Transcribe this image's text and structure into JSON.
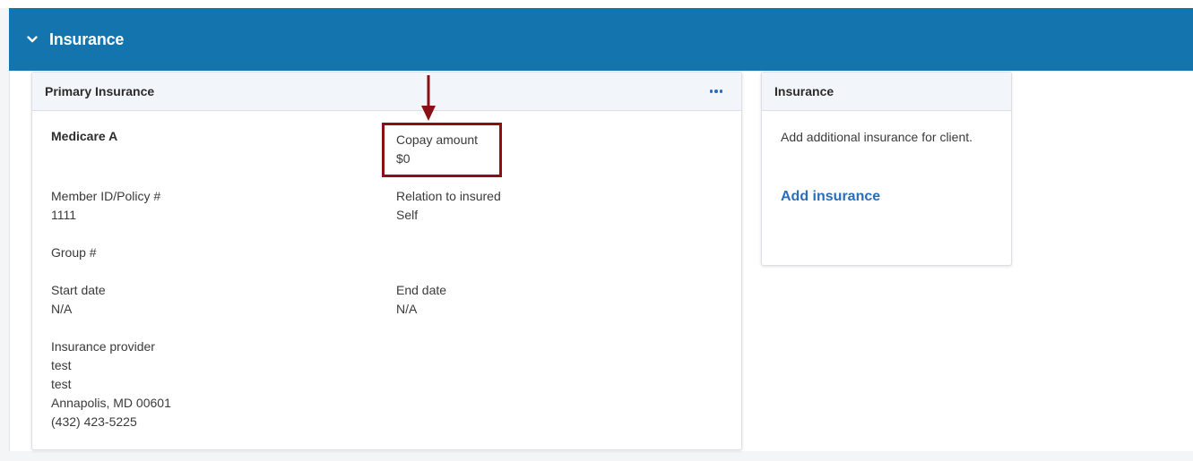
{
  "section": {
    "title": "Insurance",
    "header_color": "#1374ae",
    "collapse_icon": "chevron-down-icon"
  },
  "primary_card": {
    "title": "Primary Insurance",
    "menu_icon": "more-horizontal-icon",
    "plan_name": "Medicare A",
    "copay": {
      "label": "Copay amount",
      "value": "$0"
    },
    "member_id": {
      "label": "Member ID/Policy #",
      "value": "1111"
    },
    "relation": {
      "label": "Relation to insured",
      "value": "Self"
    },
    "group": {
      "label": "Group #",
      "value": ""
    },
    "start_date": {
      "label": "Start date",
      "value": "N/A"
    },
    "end_date": {
      "label": "End date",
      "value": "N/A"
    },
    "provider": {
      "label": "Insurance provider",
      "lines": [
        "test",
        "test",
        "Annapolis, MD 00601",
        "(432) 423-5225"
      ]
    }
  },
  "side_card": {
    "title": "Insurance",
    "description": "Add additional insurance for client.",
    "add_link": "Add insurance"
  },
  "annotation": {
    "color": "#8b0f14",
    "target": "Copay amount"
  },
  "colors": {
    "link": "#2a6ebb",
    "card_header_bg": "#f2f5f9"
  }
}
